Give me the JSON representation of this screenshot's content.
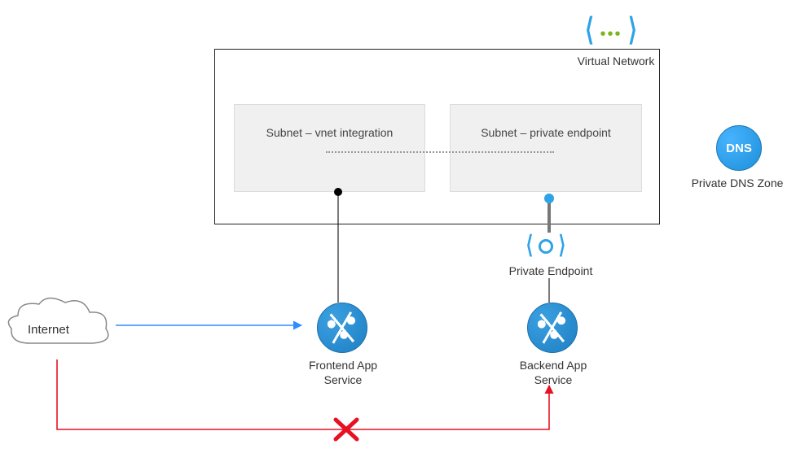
{
  "vnet": {
    "label": "Virtual Network"
  },
  "subnets": {
    "integration": "Subnet – vnet integration",
    "private_endpoint": "Subnet – private endpoint"
  },
  "private_endpoint": {
    "label": "Private Endpoint"
  },
  "frontend": {
    "label": "Frontend App\nService"
  },
  "backend": {
    "label": "Backend App\nService"
  },
  "dns": {
    "label": "Private DNS Zone",
    "badge": "DNS"
  },
  "internet": {
    "label": "Internet"
  },
  "colors": {
    "azure_blue": "#2ea3e6",
    "deny_red": "#e81123",
    "allow_blue": "#2d8cff"
  }
}
